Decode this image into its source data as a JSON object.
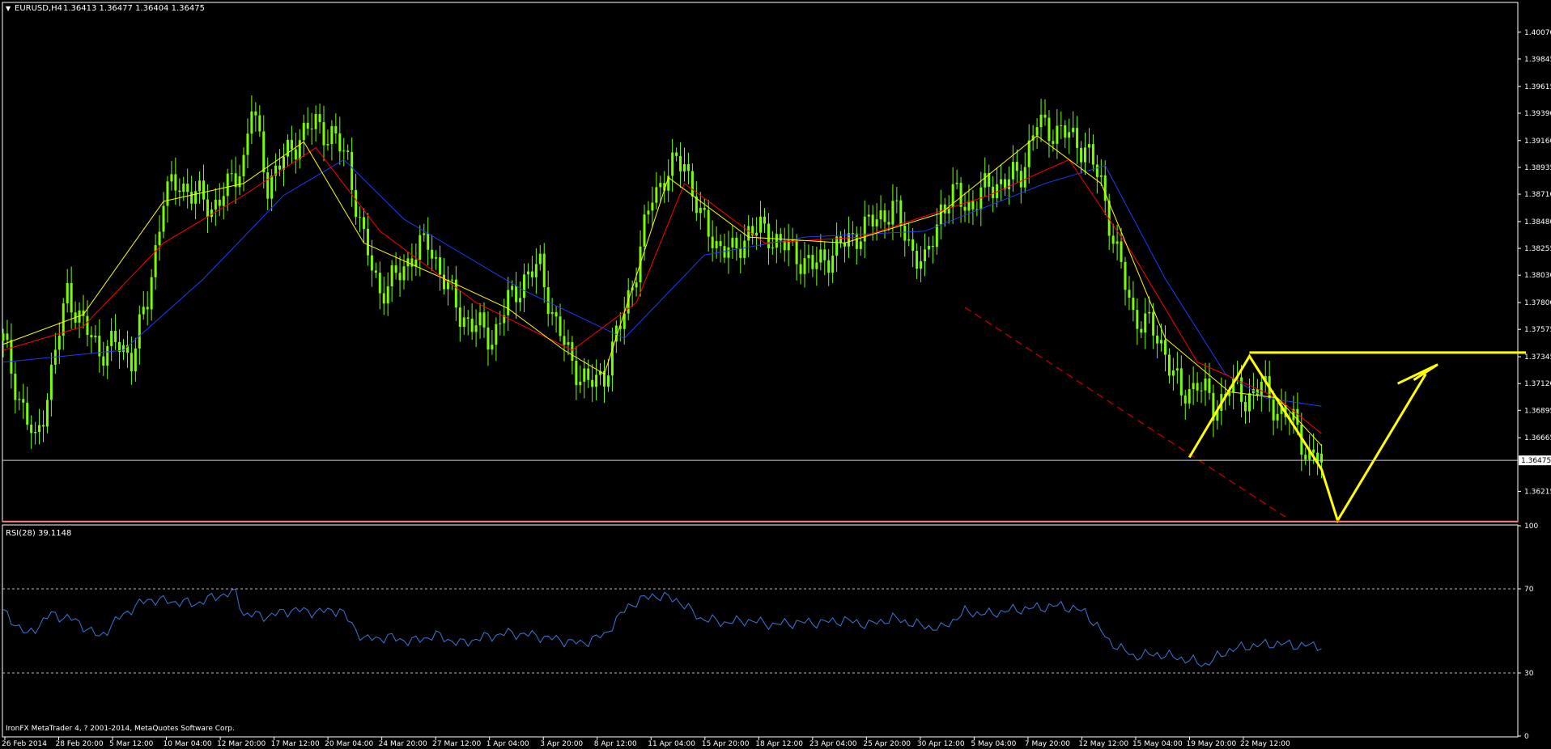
{
  "header": {
    "symbol": "EURUSD,H4",
    "ohlc": "1.36413 1.36477 1.36404 1.36475"
  },
  "rsi_header": "RSI(28) 39.1148",
  "footer_credit": "IronFX MetaTrader 4, ? 2001-2014, MetaQuotes Software Corp.",
  "current_price_label": "1.36475",
  "colors": {
    "candles": "#7CFC00",
    "ma_fast": "#ffff00",
    "ma_mid": "#ff0000",
    "ma_slow": "#1f3bff",
    "rsi_line": "#3c78d8",
    "annotation": "#ffff00",
    "trendline": "#b00000"
  },
  "chart_data": [
    {
      "type": "candlestick",
      "title": "EURUSD,H4",
      "y_ticks": [
        "1.40070",
        "1.39845",
        "1.39615",
        "1.39390",
        "1.39160",
        "1.38935",
        "1.38710",
        "1.38480",
        "1.38255",
        "1.38030",
        "1.37800",
        "1.37575",
        "1.37345",
        "1.37120",
        "1.36895",
        "1.36665",
        "1.36215"
      ],
      "ylim": [
        1.3596,
        1.4032
      ],
      "x_ticks": [
        "26 Feb 2014",
        "28 Feb 20:00",
        "5 Mar 12:00",
        "10 Mar 04:00",
        "12 Mar 20:00",
        "17 Mar 12:00",
        "20 Mar 04:00",
        "24 Mar 20:00",
        "27 Mar 12:00",
        "1 Apr 04:00",
        "3 Apr 20:00",
        "8 Apr 12:00",
        "11 Apr 04:00",
        "15 Apr 20:00",
        "18 Apr 12:00",
        "23 Apr 04:00",
        "25 Apr 20:00",
        "30 Apr 12:00",
        "5 May 04:00",
        "7 May 20:00",
        "12 May 12:00",
        "15 May 04:00",
        "19 May 20:00",
        "22 May 12:00"
      ],
      "current_price": 1.36475,
      "price_path": [
        [
          0,
          1.3748
        ],
        [
          4,
          1.37
        ],
        [
          8,
          1.366
        ],
        [
          12,
          1.372
        ],
        [
          16,
          1.379
        ],
        [
          20,
          1.376
        ],
        [
          24,
          1.374
        ],
        [
          28,
          1.3745
        ],
        [
          32,
          1.3735
        ],
        [
          36,
          1.378
        ],
        [
          40,
          1.387
        ],
        [
          44,
          1.388
        ],
        [
          48,
          1.387
        ],
        [
          52,
          1.386
        ],
        [
          56,
          1.3875
        ],
        [
          60,
          1.39
        ],
        [
          62,
          1.3945
        ],
        [
          66,
          1.388
        ],
        [
          70,
          1.39
        ],
        [
          74,
          1.392
        ],
        [
          78,
          1.393
        ],
        [
          82,
          1.392
        ],
        [
          86,
          1.39
        ],
        [
          90,
          1.383
        ],
        [
          94,
          1.379
        ],
        [
          98,
          1.38
        ],
        [
          102,
          1.382
        ],
        [
          106,
          1.383
        ],
        [
          110,
          1.38
        ],
        [
          114,
          1.377
        ],
        [
          118,
          1.376
        ],
        [
          122,
          1.375
        ],
        [
          126,
          1.378
        ],
        [
          130,
          1.38
        ],
        [
          134,
          1.381
        ],
        [
          138,
          1.376
        ],
        [
          142,
          1.373
        ],
        [
          146,
          1.371
        ],
        [
          150,
          1.372
        ],
        [
          154,
          1.376
        ],
        [
          158,
          1.381
        ],
        [
          162,
          1.387
        ],
        [
          166,
          1.389
        ],
        [
          170,
          1.39
        ],
        [
          174,
          1.385
        ],
        [
          178,
          1.383
        ],
        [
          182,
          1.382
        ],
        [
          186,
          1.384
        ],
        [
          190,
          1.384
        ],
        [
          194,
          1.383
        ],
        [
          198,
          1.382
        ],
        [
          202,
          1.381
        ],
        [
          206,
          1.382
        ],
        [
          210,
          1.383
        ],
        [
          214,
          1.384
        ],
        [
          218,
          1.385
        ],
        [
          222,
          1.386
        ],
        [
          226,
          1.383
        ],
        [
          230,
          1.381
        ],
        [
          234,
          1.386
        ],
        [
          238,
          1.387
        ],
        [
          242,
          1.386
        ],
        [
          246,
          1.388
        ],
        [
          250,
          1.388
        ],
        [
          254,
          1.389
        ],
        [
          258,
          1.393
        ],
        [
          262,
          1.3925
        ],
        [
          266,
          1.392
        ],
        [
          270,
          1.391
        ],
        [
          274,
          1.388
        ],
        [
          278,
          1.382
        ],
        [
          282,
          1.377
        ],
        [
          286,
          1.376
        ],
        [
          290,
          1.374
        ],
        [
          294,
          1.37
        ],
        [
          298,
          1.3715
        ],
        [
          302,
          1.369
        ],
        [
          306,
          1.371
        ],
        [
          310,
          1.37
        ],
        [
          314,
          1.371
        ],
        [
          318,
          1.369
        ],
        [
          322,
          1.368
        ],
        [
          326,
          1.365
        ],
        [
          329,
          1.3648
        ]
      ],
      "ma_fast_path": [
        [
          0,
          1.3745
        ],
        [
          20,
          1.377
        ],
        [
          40,
          1.3865
        ],
        [
          60,
          1.388
        ],
        [
          75,
          1.3915
        ],
        [
          90,
          1.383
        ],
        [
          110,
          1.38
        ],
        [
          126,
          1.3775
        ],
        [
          140,
          1.374
        ],
        [
          150,
          1.372
        ],
        [
          166,
          1.3885
        ],
        [
          186,
          1.3835
        ],
        [
          210,
          1.383
        ],
        [
          234,
          1.3855
        ],
        [
          258,
          1.392
        ],
        [
          274,
          1.388
        ],
        [
          290,
          1.375
        ],
        [
          306,
          1.3705
        ],
        [
          318,
          1.37
        ],
        [
          329,
          1.366
        ]
      ],
      "ma_mid_path": [
        [
          0,
          1.374
        ],
        [
          20,
          1.376
        ],
        [
          40,
          1.383
        ],
        [
          60,
          1.387
        ],
        [
          78,
          1.391
        ],
        [
          94,
          1.384
        ],
        [
          118,
          1.378
        ],
        [
          142,
          1.374
        ],
        [
          158,
          1.378
        ],
        [
          170,
          1.388
        ],
        [
          190,
          1.383
        ],
        [
          214,
          1.3835
        ],
        [
          246,
          1.387
        ],
        [
          266,
          1.39
        ],
        [
          282,
          1.382
        ],
        [
          298,
          1.373
        ],
        [
          318,
          1.37
        ],
        [
          329,
          1.367
        ]
      ],
      "ma_slow_path": [
        [
          0,
          1.373
        ],
        [
          30,
          1.374
        ],
        [
          50,
          1.38
        ],
        [
          70,
          1.387
        ],
        [
          85,
          1.39
        ],
        [
          100,
          1.385
        ],
        [
          130,
          1.379
        ],
        [
          155,
          1.375
        ],
        [
          175,
          1.382
        ],
        [
          200,
          1.3835
        ],
        [
          230,
          1.384
        ],
        [
          260,
          1.388
        ],
        [
          275,
          1.3895
        ],
        [
          290,
          1.38
        ],
        [
          305,
          1.372
        ],
        [
          315,
          1.37
        ],
        [
          329,
          1.3693
        ]
      ],
      "annotation_path": [
        [
          296,
          1.365
        ],
        [
          311,
          1.3735
        ],
        [
          329,
          1.364
        ],
        [
          333,
          1.3597
        ],
        [
          355,
          1.372
        ]
      ],
      "annotation_arrow": [
        [
          348,
          1.3712
        ],
        [
          358,
          1.3728
        ],
        [
          352,
          1.3715
        ]
      ],
      "horizontal_level": {
        "y": 1.3738,
        "x_from": 311,
        "x_to": 380
      },
      "dashed_trendline": [
        [
          240,
          1.3776
        ],
        [
          320,
          1.36
        ]
      ]
    },
    {
      "type": "line",
      "title": "RSI(28) 39.1148",
      "ylim": [
        0,
        100
      ],
      "y_ticks": [
        "100",
        "70",
        "30",
        "0"
      ],
      "levels": [
        70,
        30
      ],
      "rsi_path": [
        [
          0,
          59
        ],
        [
          6,
          48
        ],
        [
          12,
          58
        ],
        [
          18,
          55
        ],
        [
          24,
          47
        ],
        [
          30,
          58
        ],
        [
          36,
          65
        ],
        [
          42,
          64
        ],
        [
          48,
          63
        ],
        [
          54,
          67
        ],
        [
          58,
          68
        ],
        [
          60,
          58
        ],
        [
          66,
          57
        ],
        [
          72,
          60
        ],
        [
          78,
          59
        ],
        [
          84,
          60
        ],
        [
          90,
          46
        ],
        [
          96,
          47
        ],
        [
          102,
          45
        ],
        [
          108,
          48
        ],
        [
          114,
          44
        ],
        [
          120,
          47
        ],
        [
          126,
          49
        ],
        [
          132,
          48
        ],
        [
          138,
          46
        ],
        [
          144,
          44
        ],
        [
          150,
          48
        ],
        [
          156,
          62
        ],
        [
          162,
          67
        ],
        [
          168,
          65
        ],
        [
          174,
          56
        ],
        [
          180,
          54
        ],
        [
          186,
          55
        ],
        [
          192,
          53
        ],
        [
          198,
          54
        ],
        [
          204,
          54
        ],
        [
          210,
          55
        ],
        [
          216,
          53
        ],
        [
          222,
          56
        ],
        [
          228,
          53
        ],
        [
          234,
          51
        ],
        [
          240,
          59
        ],
        [
          246,
          58
        ],
        [
          252,
          60
        ],
        [
          258,
          61
        ],
        [
          264,
          62
        ],
        [
          270,
          59
        ],
        [
          276,
          45
        ],
        [
          282,
          38
        ],
        [
          288,
          39
        ],
        [
          294,
          37
        ],
        [
          300,
          34
        ],
        [
          306,
          41
        ],
        [
          312,
          43
        ],
        [
          318,
          44
        ],
        [
          324,
          43
        ],
        [
          329,
          43
        ]
      ]
    }
  ]
}
